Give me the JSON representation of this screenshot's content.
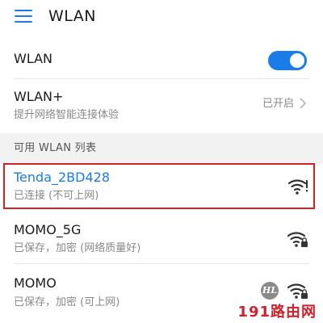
{
  "header": {
    "title": "WLAN",
    "menu_icon": "hamburger-menu-icon"
  },
  "wlan_toggle": {
    "label": "WLAN",
    "enabled": true
  },
  "wlan_plus": {
    "label": "WLAN+",
    "description": "提升网络智能连接体验",
    "status": "已开启"
  },
  "networks_section": {
    "label": "可用 WLAN 列表"
  },
  "networks": [
    {
      "name": "Tenda_2BD428",
      "status": "已连接 (不可上网)",
      "connected": true,
      "secured": false,
      "icon": "wifi-warning-icon"
    },
    {
      "name": "MOMO_5G",
      "status": "已保存，加密 (网络质量好)",
      "connected": false,
      "secured": true,
      "icon": "wifi-lock-icon"
    },
    {
      "name": "MOMO",
      "status": "已保存，加密 (可上网)",
      "connected": false,
      "secured": true,
      "icon": "wifi-lock-icon",
      "badge": "HL"
    }
  ],
  "colors": {
    "accent": "#1a7ce8",
    "highlight_border": "#d0202a",
    "secondary_text": "#888888",
    "section_bg": "#f2f2f2"
  },
  "watermark": "191路由网"
}
